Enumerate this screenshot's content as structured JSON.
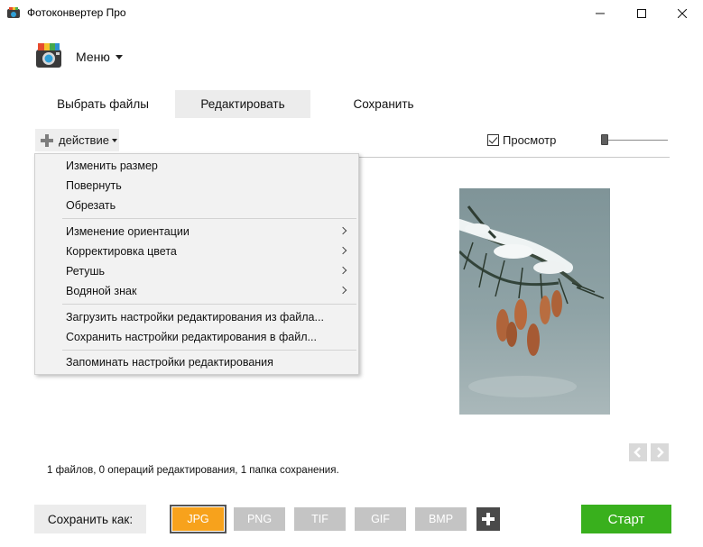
{
  "window": {
    "title": "Фотоконвертер Про",
    "icon": "app-logo-icon",
    "controls": [
      "minimize-icon",
      "maximize-icon",
      "close-icon"
    ]
  },
  "menu": {
    "label": "Меню"
  },
  "tabs": [
    {
      "label": "Выбрать файлы",
      "active": false
    },
    {
      "label": "Редактировать",
      "active": true
    },
    {
      "label": "Сохранить",
      "active": false
    }
  ],
  "toolbar": {
    "action_label": "действие",
    "preview_label": "Просмотр",
    "preview_checked": true
  },
  "dropdown": {
    "items": [
      {
        "label": "Изменить размер",
        "submenu": false
      },
      {
        "label": "Повернуть",
        "submenu": false
      },
      {
        "label": "Обрезать",
        "submenu": false
      },
      {
        "label": "Изменение ориентации",
        "submenu": true
      },
      {
        "label": "Корректировка цвета",
        "submenu": true
      },
      {
        "label": "Ретушь",
        "submenu": true
      },
      {
        "label": "Водяной знак",
        "submenu": true
      },
      {
        "label": "Загрузить настройки редактирования из файла...",
        "submenu": false
      },
      {
        "label": "Сохранить настройки редактирования в файл...",
        "submenu": false
      },
      {
        "label": "Запоминать настройки редактирования",
        "submenu": false
      }
    ]
  },
  "preview": {
    "icons": [
      "chevron-left-icon",
      "chevron-right-icon"
    ]
  },
  "status": "1 файлов, 0 операций редактирования, 1 папка сохранения.",
  "bottom": {
    "save_as_label": "Сохранить как:",
    "formats": [
      {
        "label": "JPG",
        "active": true
      },
      {
        "label": "PNG",
        "active": false
      },
      {
        "label": "TIF",
        "active": false
      },
      {
        "label": "GIF",
        "active": false
      },
      {
        "label": "BMP",
        "active": false
      }
    ],
    "start_label": "Старт"
  },
  "colors": {
    "accent_orange": "#f7a21c",
    "start_green": "#39b01d",
    "format_inactive": "#c4c4c4",
    "tab_active_bg": "#ececec"
  }
}
